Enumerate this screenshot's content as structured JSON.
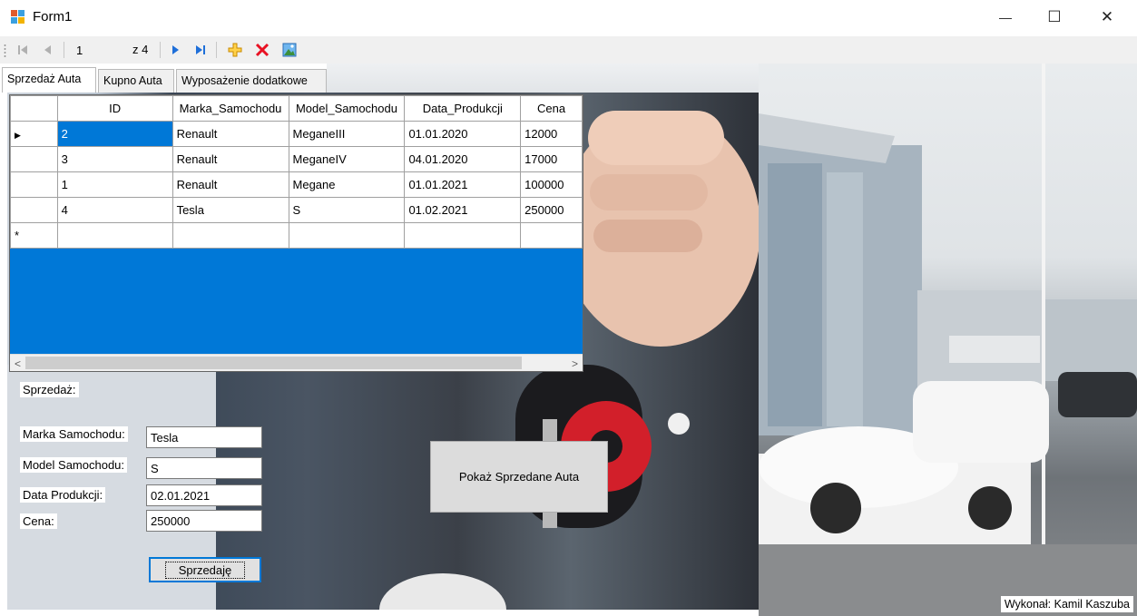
{
  "window": {
    "title": "Form1",
    "minimize_glyph": "—",
    "maximize_glyph": "☐",
    "close_glyph": "✕"
  },
  "navigator": {
    "position": "1",
    "count_label": "z 4"
  },
  "tabs": [
    "Sprzedaż Auta",
    "Kupno Auta",
    "Wyposażenie dodatkowe"
  ],
  "grid": {
    "columns": [
      "ID",
      "Marka_Samochodu",
      "Model_Samochodu",
      "Data_Produkcji",
      "Cena"
    ],
    "rows": [
      [
        "2",
        "Renault",
        "MeganeIII",
        "01.01.2020",
        "12000"
      ],
      [
        "3",
        "Renault",
        "MeganeIV",
        "04.01.2020",
        "17000"
      ],
      [
        "1",
        "Renault",
        "Megane",
        "01.01.2021",
        "100000"
      ],
      [
        "4",
        "Tesla",
        "S",
        "01.02.2021",
        "250000"
      ]
    ],
    "current_row_glyph": "▶",
    "new_row_glyph": "*",
    "scroll_left": "<",
    "scroll_right": ">"
  },
  "form": {
    "section_label": "Sprzedaż:",
    "marka_label": "Marka Samochodu:",
    "marka_value": "Tesla",
    "model_label": "Model Samochodu:",
    "model_value": "S",
    "data_label": "Data Produkcji:",
    "data_value": "02.01.2021",
    "cena_label": "Cena:",
    "cena_value": "250000",
    "sell_button": "Sprzedaję",
    "show_sold_button": "Pokaż Sprzedane Auta"
  },
  "footer": {
    "author": "Wykonał: Kamil Kaszuba"
  },
  "colors": {
    "selection": "#0078d7",
    "delete": "#e81123",
    "add": "#f2a900",
    "nav_arrow": "#1e6fd9"
  }
}
